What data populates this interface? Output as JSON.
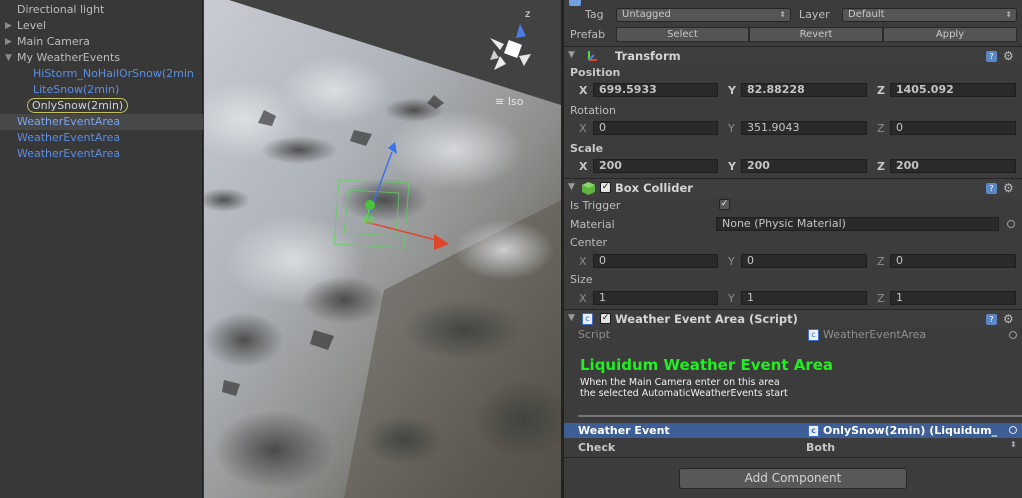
{
  "hierarchy": {
    "items": [
      {
        "label": "Directional light"
      },
      {
        "label": "Level"
      },
      {
        "label": "Main Camera"
      },
      {
        "label": "My WeatherEvents"
      },
      {
        "label": "HiStorm_NoHailOrSnow(2min"
      },
      {
        "label": "LiteSnow(2min)"
      },
      {
        "label": "OnlySnow(2min)"
      },
      {
        "label": "WeatherEventArea"
      },
      {
        "label": "WeatherEventArea"
      },
      {
        "label": "WeatherEventArea"
      }
    ]
  },
  "scene": {
    "projection_label": "Iso",
    "gizmo_axis_label": "z"
  },
  "inspector": {
    "tag_label": "Tag",
    "tag_value": "Untagged",
    "layer_label": "Layer",
    "layer_value": "Default",
    "prefab_label": "Prefab",
    "prefab_select": "Select",
    "prefab_revert": "Revert",
    "prefab_apply": "Apply",
    "transform": {
      "title": "Transform",
      "position_label": "Position",
      "position": {
        "x": "699.5933",
        "y": "82.88228",
        "z": "1405.092"
      },
      "rotation_label": "Rotation",
      "rotation": {
        "x": "0",
        "y": "351.9043",
        "z": "0"
      },
      "scale_label": "Scale",
      "scale": {
        "x": "200",
        "y": "200",
        "z": "200"
      }
    },
    "box_collider": {
      "title": "Box Collider",
      "is_trigger_label": "Is Trigger",
      "material_label": "Material",
      "material_value": "None (Physic Material)",
      "center_label": "Center",
      "center": {
        "x": "0",
        "y": "0",
        "z": "0"
      },
      "size_label": "Size",
      "size": {
        "x": "1",
        "y": "1",
        "z": "1"
      }
    },
    "weather_script": {
      "title": "Weather Event Area (Script)",
      "script_label": "Script",
      "script_value": "WeatherEventArea",
      "heading": "Liquidum Weather Event Area",
      "description_line1": "When the Main Camera enter on this area",
      "description_line2": "the selected AutomaticWeatherEvents start",
      "weather_event_label": "Weather Event",
      "weather_event_value": "OnlySnow(2min) (Liquidum_",
      "check_label": "Check",
      "check_value": "Both"
    },
    "axis_x": "X",
    "axis_y": "Y",
    "axis_z": "Z",
    "add_component": "Add Component"
  },
  "colors": {
    "hierarchy_blue": "#5b8fe6",
    "selection_ring": "#c4c261",
    "heading_green": "#22ee22",
    "selected_row": "#3e5f96"
  }
}
